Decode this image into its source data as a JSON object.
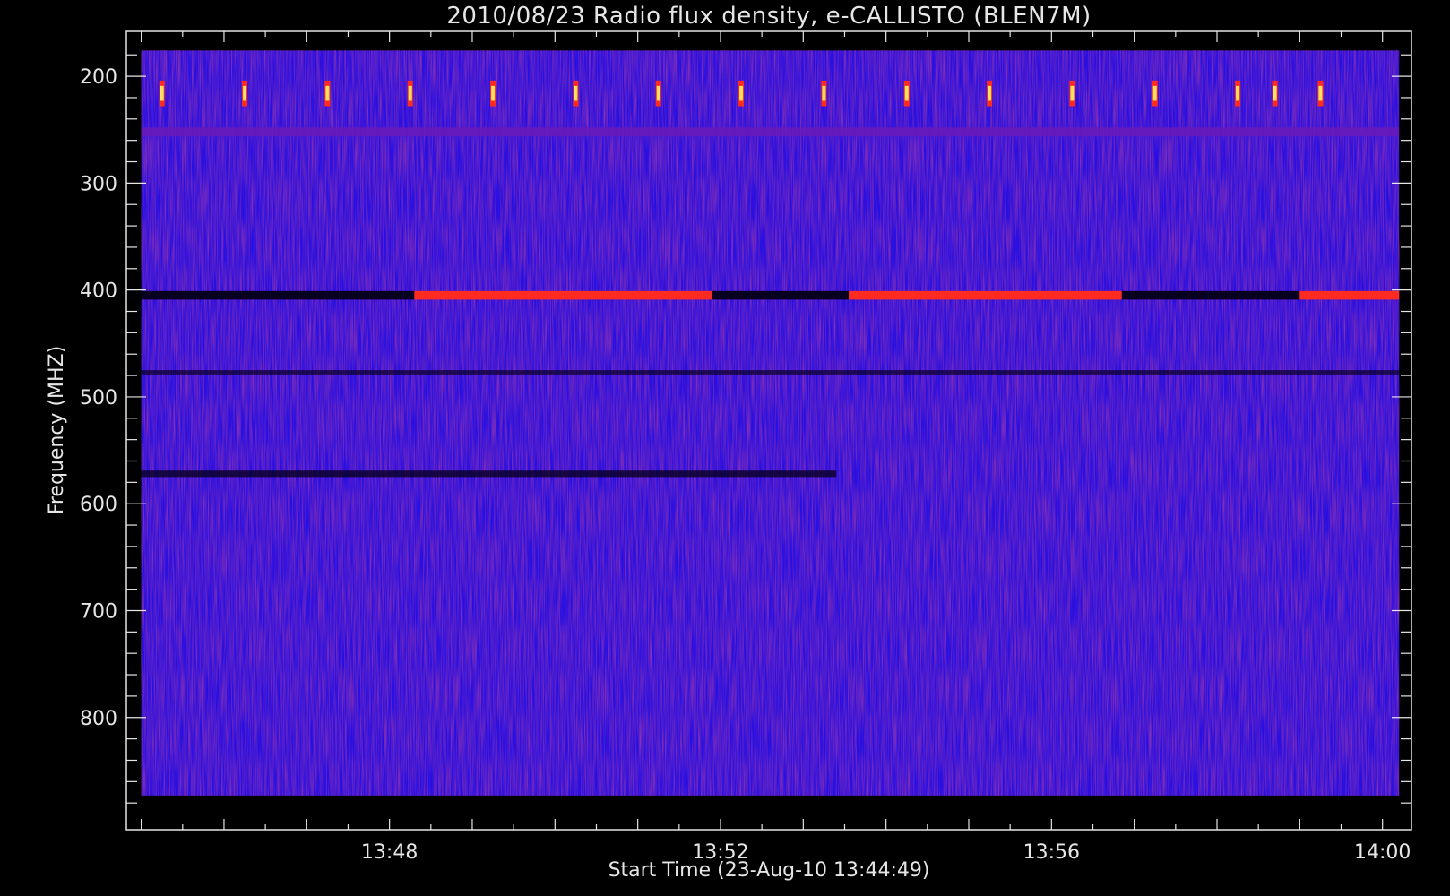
{
  "chart_data": {
    "type": "heatmap",
    "title": "2010/08/23  Radio flux density, e-CALLISTO (BLEN7M)",
    "xlabel": "Start Time (23-Aug-10 13:44:49)",
    "ylabel": "Frequency (MHZ)",
    "x_tick_labels": [
      "13:48",
      "13:52",
      "13:56",
      "14:00"
    ],
    "x_tick_minutes": [
      828,
      832,
      836,
      840
    ],
    "y_tick_labels": [
      "200",
      "300",
      "400",
      "500",
      "600",
      "700",
      "800"
    ],
    "y_tick_values": [
      200,
      300,
      400,
      500,
      600,
      700,
      800
    ],
    "xlim_minutes": [
      824.82,
      840.35
    ],
    "data_x_range_minutes": [
      825.0,
      840.2
    ],
    "ylim": [
      176,
      873
    ],
    "y_inverted": true,
    "colors": {
      "background": "#000000",
      "frame": "#e6e6e6",
      "low": "#2a10e0",
      "mid": "#6a1ab8",
      "high": "#ff2a20",
      "peak": "#ffe060",
      "dark": "#080020"
    },
    "features": {
      "periodic_bursts": {
        "freq_range": [
          204,
          228
        ],
        "times_minutes": [
          825.25,
          826.25,
          827.25,
          828.25,
          829.25,
          830.25,
          831.25,
          832.25,
          833.25,
          834.25,
          835.25,
          836.25,
          837.25,
          838.25,
          838.7,
          839.25
        ]
      },
      "band_405": [
        {
          "start": 825.0,
          "end": 828.3,
          "level": "dark"
        },
        {
          "start": 828.3,
          "end": 829.9,
          "level": "high"
        },
        {
          "start": 829.9,
          "end": 831.9,
          "level": "high"
        },
        {
          "start": 831.9,
          "end": 833.55,
          "level": "dark"
        },
        {
          "start": 833.55,
          "end": 836.85,
          "level": "high"
        },
        {
          "start": 836.85,
          "end": 837.9,
          "level": "dark"
        },
        {
          "start": 837.9,
          "end": 839.0,
          "level": "dark"
        },
        {
          "start": 839.0,
          "end": 840.2,
          "level": "high"
        }
      ],
      "band_252": {
        "freq": 252,
        "level": "mid"
      },
      "band_477": {
        "freq": 477,
        "level": "dark"
      },
      "band_572": {
        "freq": 572,
        "level": "dark",
        "end_minutes": 833.4
      }
    }
  }
}
